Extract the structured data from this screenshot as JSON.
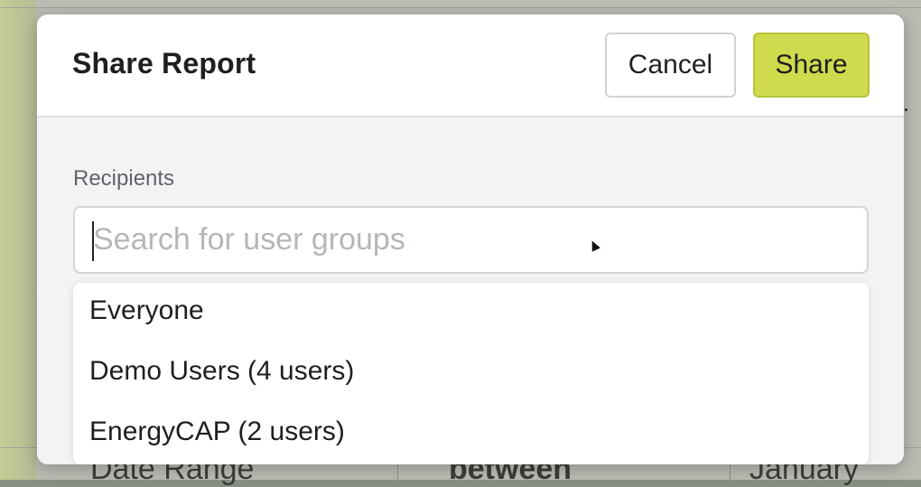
{
  "modal": {
    "title": "Share Report",
    "cancel_label": "Cancel",
    "share_label": "Share",
    "accent_color": "#cfdb4d"
  },
  "recipients": {
    "label": "Recipients",
    "search_placeholder": "Search for user groups",
    "search_value": "",
    "options": [
      {
        "label": "Everyone"
      },
      {
        "label": "Demo Users (4 users)"
      },
      {
        "label": "EnergyCAP (2 users)"
      }
    ]
  },
  "background": {
    "row_label": "Date Range",
    "operator": "between",
    "value": "January"
  }
}
